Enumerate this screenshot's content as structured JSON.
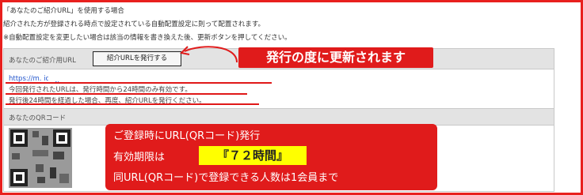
{
  "intro": {
    "line1": "「あなたのご紹介URL」を使用する場合",
    "line2": "紹介された方が登録される時点で設定されている自動配置設定に則って配置されます。",
    "line3": "※自動配置設定を変更したい場合は該当の情報を書き換えた後、更新ボタンを押してください。"
  },
  "url_section": {
    "label": "あなたのご紹介用URL",
    "issue_button": "紹介URLを発行する",
    "url": "https://m.        ice.jp/EC                     子El",
    "note1": "今回発行されたURLは、発行時間から24時間のみ有効です。",
    "note2": "発行後24時間を経過した場合、再度、紹介URLを発行ください。"
  },
  "qr_section": {
    "label": "あなたのQRコード"
  },
  "callout": {
    "text": "発行の度に更新されます"
  },
  "info_box": {
    "line1": "ご登録時にURL(QRコード)発行",
    "line2_prefix": "有効期限は",
    "line2_highlight": "『７２時間』",
    "line3": "同URL(QRコード)で登録できる人数は1会員まで"
  },
  "colors": {
    "accent_red": "#e01b1b",
    "highlight_yellow": "#ffff00",
    "link_blue": "#2255cc"
  }
}
